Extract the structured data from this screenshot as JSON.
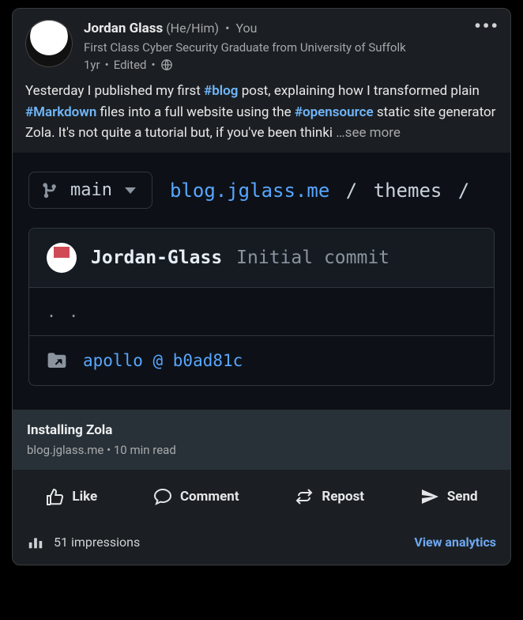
{
  "header": {
    "name": "Jordan Glass",
    "pronouns": "(He/Him)",
    "you": "You",
    "headline": "First Class Cyber Security Graduate from University of Suffolk",
    "age": "1yr",
    "edited": "Edited"
  },
  "post": {
    "text_pre": "Yesterday I published my first ",
    "hash_blog": "#blog",
    "text_mid1": " post, explaining how I transformed plain ",
    "hash_md": "#Markdown",
    "text_mid2": " files into a full website using the ",
    "hash_os": "#opensource",
    "text_mid3": " static site generator Zola. It's not quite a tutorial but, if you've been thinki",
    "see_more": "   …see more"
  },
  "preview": {
    "branch": "main",
    "repo": "blog.jglass.me",
    "crumb1": "themes",
    "commit_user": "Jordan-Glass",
    "commit_msg": "Initial commit",
    "row_dots": ". .",
    "submodule": "apollo @ b0ad81c"
  },
  "linkcard": {
    "title": "Installing Zola",
    "sub": "blog.jglass.me • 10 min read"
  },
  "actions": {
    "like": "Like",
    "comment": "Comment",
    "repost": "Repost",
    "send": "Send"
  },
  "footer": {
    "impressions": "51 impressions",
    "analytics": "View analytics"
  }
}
